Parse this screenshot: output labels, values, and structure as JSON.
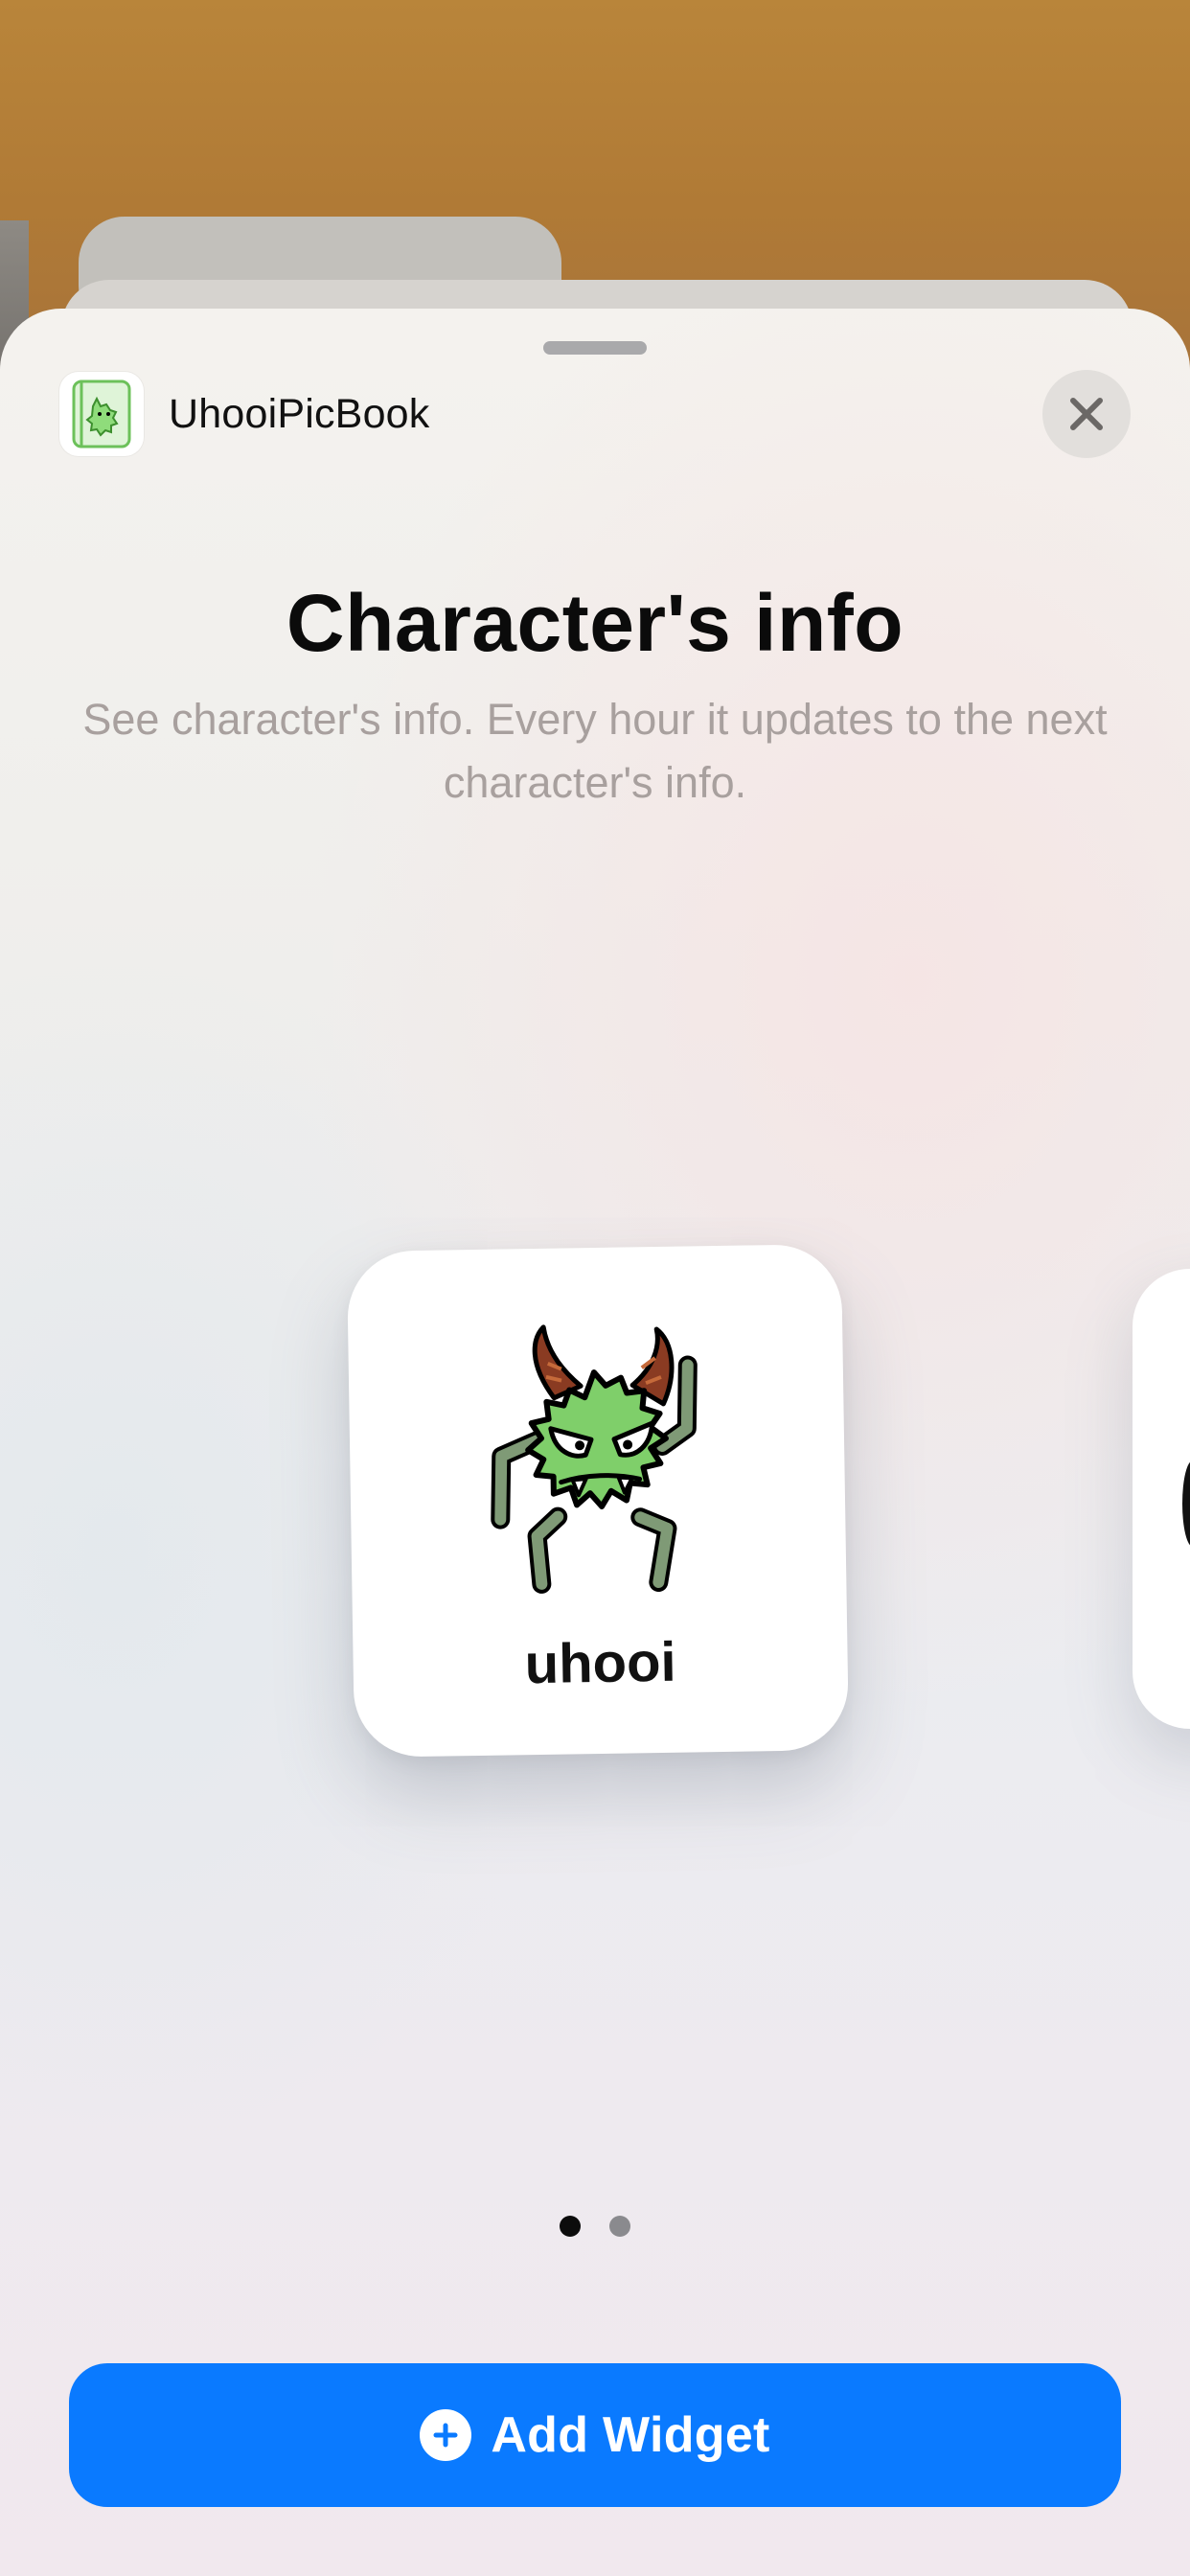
{
  "app": {
    "name": "UhooiPicBook",
    "icon": "uhooi-app-icon"
  },
  "sheet": {
    "close_icon": "close-icon"
  },
  "widget": {
    "title": "Character's info",
    "description": "See character's info. Every hour it updates to the next character's info.",
    "preview": {
      "character_name": "uhooi",
      "character_image": "green-monster-illustration"
    }
  },
  "pagination": {
    "current_page": 1,
    "total_pages": 2
  },
  "actions": {
    "add_widget_label": "Add Widget",
    "add_widget_icon": "plus-circle-icon"
  },
  "colors": {
    "accent": "#0A7AFF",
    "character_green": "#7fcf6a",
    "horn_brown": "#8a3b22"
  }
}
